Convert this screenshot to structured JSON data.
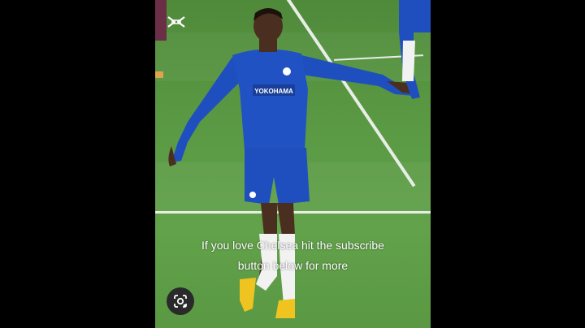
{
  "video": {
    "caption_line1": "If you love Chelsea hit the subscribe",
    "caption_line2": "button below for more"
  },
  "icons": {
    "watermark": "capcut-logo-icon",
    "lens": "google-lens-icon"
  },
  "colors": {
    "pitch": "#5b9a44",
    "kit_blue": "#1f4fbf",
    "background": "#000000"
  }
}
